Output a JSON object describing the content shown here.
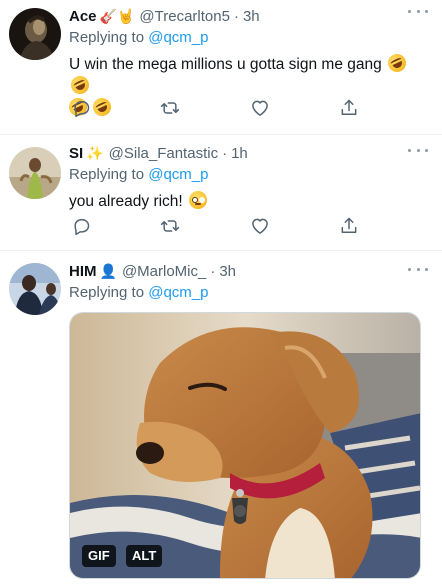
{
  "tweets": [
    {
      "display_name": "Ace",
      "name_emojis": "🎸🤘",
      "handle": "@Trecarlton5",
      "time": "3h",
      "replying_prefix": "Replying to ",
      "replying_to": "@qcm_p",
      "text": "U win the mega millions u gotta sign me gang",
      "emojis": [
        "rolling-on-floor-laughing",
        "rolling-on-floor-laughing",
        "rolling-on-floor-laughing",
        "rolling-on-floor-laughing"
      ]
    },
    {
      "display_name": "SI",
      "name_emojis": "✨",
      "handle": "@Sila_Fantastic",
      "time": "1h",
      "replying_prefix": "Replying to ",
      "replying_to": "@qcm_p",
      "text": "you already rich!",
      "emojis": [
        "flushed-face"
      ]
    },
    {
      "display_name": "HIM",
      "name_emojis": "👤",
      "handle": "@MarloMic_",
      "time": "3h",
      "replying_prefix": "Replying to ",
      "replying_to": "@qcm_p",
      "media": {
        "type": "gif",
        "subject": "dachshund dog with red collar side-eyeing",
        "gif_badge": "GIF",
        "alt_badge": "ALT"
      }
    }
  ],
  "separator": "·",
  "colors": {
    "link": "#1d9bf0",
    "secondary_text": "#536471",
    "divider": "#eff3f4"
  },
  "icons": [
    "reply-icon",
    "retweet-icon",
    "like-icon",
    "share-icon",
    "more-icon"
  ]
}
